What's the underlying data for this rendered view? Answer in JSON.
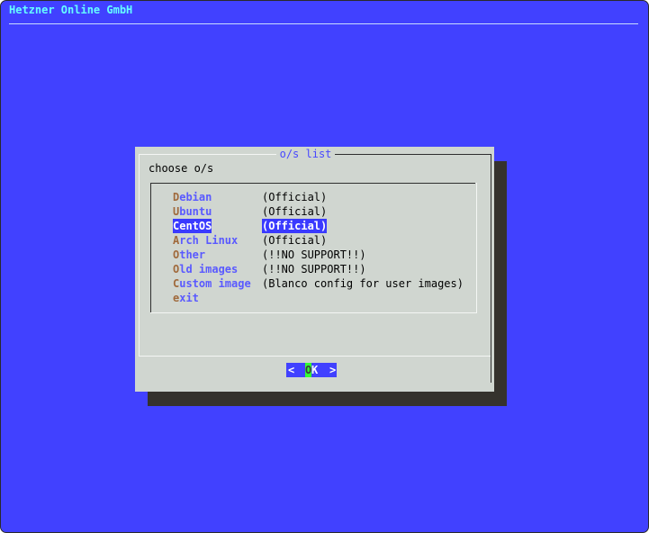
{
  "backtitle": "Hetzner Online GmbH",
  "dialog": {
    "title": "o/s list",
    "prompt": "choose o/s",
    "menu": [
      {
        "hot": "D",
        "rest": "ebian",
        "desc": "(Official)",
        "selected": false
      },
      {
        "hot": "U",
        "rest": "buntu",
        "desc": "(Official)",
        "selected": false
      },
      {
        "hot": "C",
        "rest": "entOS",
        "desc": "(Official)",
        "selected": true
      },
      {
        "hot": "A",
        "rest": "rch Linux",
        "desc": "(Official)",
        "selected": false
      },
      {
        "hot": "O",
        "rest": "ther",
        "desc": "(!!NO SUPPORT!!)",
        "selected": false
      },
      {
        "hot": "O",
        "rest": "ld images",
        "desc": "(!!NO SUPPORT!!)",
        "selected": false
      },
      {
        "hot": "C",
        "rest": "ustom image",
        "desc": "(Blanco config for user images)",
        "selected": false
      },
      {
        "hot": "e",
        "rest": "xit",
        "desc": "",
        "selected": false
      }
    ],
    "ok_button": {
      "left": "<",
      "hot": "O",
      "rest": "K",
      "right": ">"
    }
  },
  "colors": {
    "background": "#4141ff",
    "dialog": "#d0d6d0",
    "shadow": "#35322d",
    "backtitle": "#66ffff",
    "tag": "#5a5aff",
    "hotkey": "#a06a3c",
    "selected": "#3a3aff",
    "ok_hotkey": "#33ff33"
  }
}
